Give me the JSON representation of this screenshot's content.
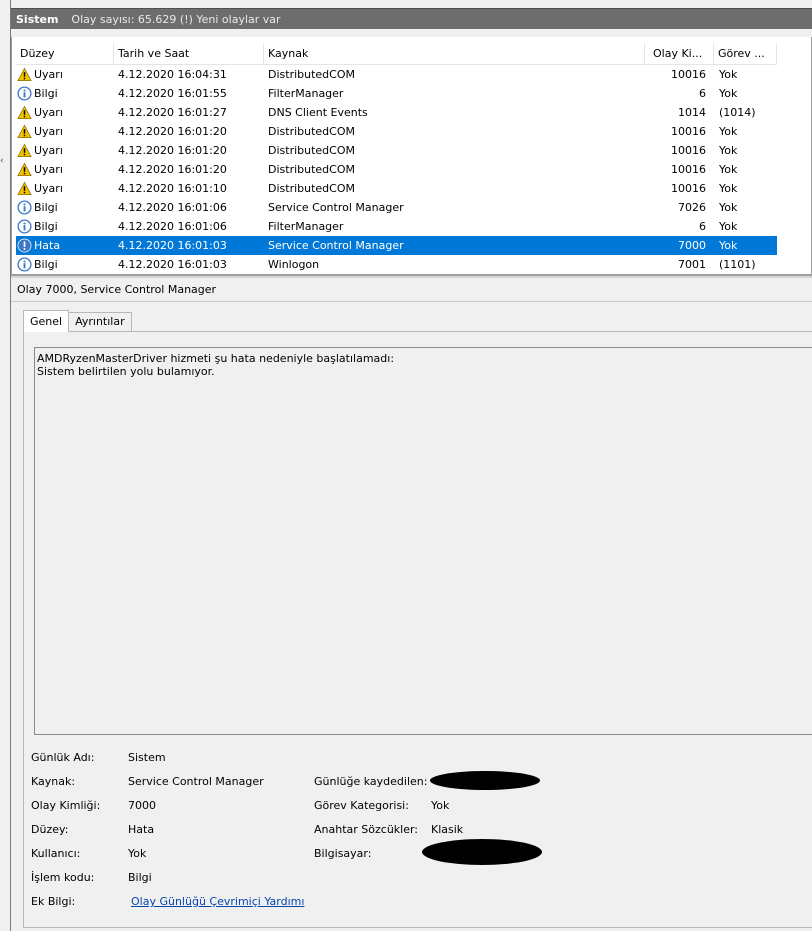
{
  "title": {
    "log_name": "Sistem",
    "summary": "Olay sayısı: 65.629 (!) Yeni olaylar var"
  },
  "columns": {
    "level": "Düzey",
    "datetime": "Tarih ve Saat",
    "source": "Kaynak",
    "event_id": "Olay Ki...",
    "task": "Görev ..."
  },
  "events": [
    {
      "icon": "warning",
      "level": "Uyarı",
      "datetime": "4.12.2020 16:04:31",
      "source": "DistributedCOM",
      "event_id": "10016",
      "task": "Yok"
    },
    {
      "icon": "info",
      "level": "Bilgi",
      "datetime": "4.12.2020 16:01:55",
      "source": "FilterManager",
      "event_id": "6",
      "task": "Yok"
    },
    {
      "icon": "warning",
      "level": "Uyarı",
      "datetime": "4.12.2020 16:01:27",
      "source": "DNS Client Events",
      "event_id": "1014",
      "task": "(1014)"
    },
    {
      "icon": "warning",
      "level": "Uyarı",
      "datetime": "4.12.2020 16:01:20",
      "source": "DistributedCOM",
      "event_id": "10016",
      "task": "Yok"
    },
    {
      "icon": "warning",
      "level": "Uyarı",
      "datetime": "4.12.2020 16:01:20",
      "source": "DistributedCOM",
      "event_id": "10016",
      "task": "Yok"
    },
    {
      "icon": "warning",
      "level": "Uyarı",
      "datetime": "4.12.2020 16:01:20",
      "source": "DistributedCOM",
      "event_id": "10016",
      "task": "Yok"
    },
    {
      "icon": "warning",
      "level": "Uyarı",
      "datetime": "4.12.2020 16:01:10",
      "source": "DistributedCOM",
      "event_id": "10016",
      "task": "Yok"
    },
    {
      "icon": "info",
      "level": "Bilgi",
      "datetime": "4.12.2020 16:01:06",
      "source": "Service Control Manager",
      "event_id": "7026",
      "task": "Yok"
    },
    {
      "icon": "info",
      "level": "Bilgi",
      "datetime": "4.12.2020 16:01:06",
      "source": "FilterManager",
      "event_id": "6",
      "task": "Yok"
    },
    {
      "icon": "error",
      "level": "Hata",
      "datetime": "4.12.2020 16:01:03",
      "source": "Service Control Manager",
      "event_id": "7000",
      "task": "Yok",
      "selected": true
    },
    {
      "icon": "info",
      "level": "Bilgi",
      "datetime": "4.12.2020 16:01:03",
      "source": "Winlogon",
      "event_id": "7001",
      "task": "(1101)"
    }
  ],
  "detail": {
    "title": "Olay 7000, Service Control Manager",
    "tabs": [
      "Genel",
      "Ayrıntılar"
    ],
    "message_line1": "AMDRyzenMasterDriver hizmeti şu hata nedeniyle başlatılamadı:",
    "message_line2": "Sistem belirtilen yolu bulamıyor.",
    "fields": {
      "log_name_label": "Günlük Adı:",
      "log_name_value": "Sistem",
      "source_label": "Kaynak:",
      "source_value": "Service Control Manager",
      "logged_label": "Günlüğe kaydedilen:",
      "event_id_label": "Olay Kimliği:",
      "event_id_value": "7000",
      "task_category_label": "Görev Kategorisi:",
      "task_category_value": "Yok",
      "level_label": "Düzey:",
      "level_value": "Hata",
      "keywords_label": "Anahtar Sözcükler:",
      "keywords_value": "Klasik",
      "user_label": "Kullanıcı:",
      "user_value": "Yok",
      "computer_label": "Bilgisayar:",
      "opcode_label": "İşlem kodu:",
      "opcode_value": "Bilgi",
      "more_info_label": "Ek Bilgi:",
      "more_info_link": "Olay Günlüğü Çevrimiçi Yardımı"
    }
  },
  "colors": {
    "selection": "#0078d7",
    "titlebar": "#6d6d6d",
    "warning": "#f5c400",
    "info": "#3c78c8",
    "error": "#3c78c8"
  }
}
